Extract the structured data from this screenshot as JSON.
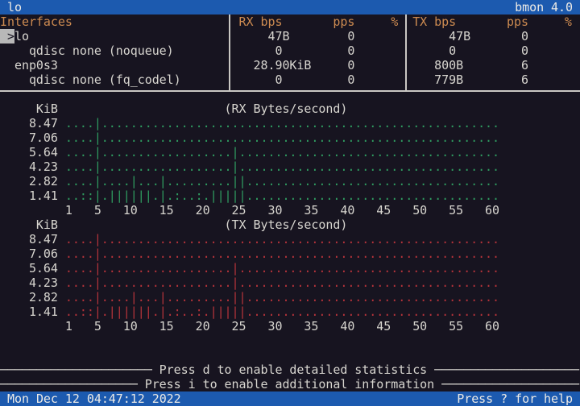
{
  "title_bar": {
    "left": "lo",
    "right": "bmon 4.0"
  },
  "list": {
    "header_line": "Interfaces                       RX bps       pps     %  TX bps       pps     %",
    "selection_marker": " >",
    "rows": [
      {
        "name": "lo",
        "rx_bps": "47B",
        "rx_pps": "0",
        "tx_bps": "47B",
        "tx_pps": "0",
        "line": "lo                                 47B        0             47B       0"
      },
      {
        "name": "qdisc none (noqueue)",
        "rx_bps": "0",
        "rx_pps": "0",
        "tx_bps": "0",
        "tx_pps": "0",
        "line": "    qdisc none (noqueue)              0         0             0         0"
      },
      {
        "name": "enp0s3",
        "rx_bps": "28.90KiB",
        "rx_pps": "0",
        "tx_bps": "800B",
        "tx_pps": "6",
        "line": "  enp0s3                           28.90KiB     0           800B        6"
      },
      {
        "name": "qdisc none (fq_codel)",
        "rx_bps": "0",
        "rx_pps": "0",
        "tx_bps": "779B",
        "tx_pps": "6",
        "line": "    qdisc none (fq_codel)             0         0           779B        6"
      }
    ]
  },
  "rx_graph": {
    "unit": "KiB",
    "title_line": "     KiB                       (RX Bytes/second)",
    "rows": [
      {
        "label": "    8.47 ",
        "plot": "....|......................................................."
      },
      {
        "label": "    7.06 ",
        "plot": "....|......................................................."
      },
      {
        "label": "    5.64 ",
        "plot": "....|..................|...................................."
      },
      {
        "label": "    4.23 ",
        "plot": "....|..................|...................................."
      },
      {
        "label": "    2.82 ",
        "plot": "....|....|...|.........||..................................."
      },
      {
        "label": "    1.41 ",
        "plot": "..::|.||||||.|.:..:.|||||..................................."
      }
    ],
    "x_axis_line": "         1   5   10   15   20   25   30   35   40   45   50   55   60"
  },
  "tx_graph": {
    "unit": "KiB",
    "title_line": "     KiB                       (TX Bytes/second)",
    "rows": [
      {
        "label": "    8.47 ",
        "plot": "....|......................................................."
      },
      {
        "label": "    7.06 ",
        "plot": "....|......................................................."
      },
      {
        "label": "    5.64 ",
        "plot": "....|..................|...................................."
      },
      {
        "label": "    4.23 ",
        "plot": "....|..................|...................................."
      },
      {
        "label": "    2.82 ",
        "plot": "....|....|...|.........||..................................."
      },
      {
        "label": "    1.41 ",
        "plot": "..::|.||||||.|.:..:.|||||..................................."
      }
    ],
    "x_axis_line": "         1   5   10   15   20   25   30   35   40   45   50   55   60"
  },
  "chart_data": [
    {
      "type": "area",
      "title": "(RX Bytes/second)",
      "ylabel": "KiB",
      "yticks": [
        8.47,
        7.06,
        5.64,
        4.23,
        2.82,
        1.41
      ],
      "xticks": [
        1,
        5,
        10,
        15,
        20,
        25,
        30,
        35,
        40,
        45,
        50,
        55,
        60
      ],
      "xrange": [
        1,
        60
      ],
      "peaks_kib_by_x": {
        "3": 0.7,
        "4": 0.7,
        "5": 8.5,
        "7": 1.4,
        "8": 1.4,
        "9": 1.4,
        "10": 2.8,
        "11": 1.4,
        "12": 1.4,
        "14": 2.8,
        "16": 0.7,
        "19": 0.7,
        "21": 1.4,
        "22": 1.4,
        "23": 1.4,
        "24": 5.6,
        "25": 2.8
      },
      "color": "#2f9c60"
    },
    {
      "type": "area",
      "title": "(TX Bytes/second)",
      "ylabel": "KiB",
      "yticks": [
        8.47,
        7.06,
        5.64,
        4.23,
        2.82,
        1.41
      ],
      "xticks": [
        1,
        5,
        10,
        15,
        20,
        25,
        30,
        35,
        40,
        45,
        50,
        55,
        60
      ],
      "xrange": [
        1,
        60
      ],
      "peaks_kib_by_x": {
        "3": 0.7,
        "4": 0.7,
        "5": 8.5,
        "7": 1.4,
        "8": 1.4,
        "9": 1.4,
        "10": 2.8,
        "11": 1.4,
        "12": 1.4,
        "14": 2.8,
        "16": 0.7,
        "19": 0.7,
        "21": 1.4,
        "22": 1.4,
        "23": 1.4,
        "24": 5.6,
        "25": 2.8
      },
      "color": "#b4333a"
    }
  ],
  "messages": {
    "detailed_line": "───────────────────── Press d to enable detailed statistics ────────────────────",
    "additional_line": "─────────────────── Press i to enable additional information ───────────────────"
  },
  "status_bar": {
    "datetime": "Mon Dec 12 04:47:12 2022",
    "help": "Press ? for help"
  },
  "colors": {
    "background": "#171420",
    "foreground": "#d8d6d0",
    "bar_blue": "#1c5aaf",
    "header_orange": "#cd8b51",
    "rx_green": "#2f9c60",
    "tx_red": "#b4333a",
    "selection_gray": "#b8b8b8",
    "separator_gray": "#c9c7c3"
  }
}
